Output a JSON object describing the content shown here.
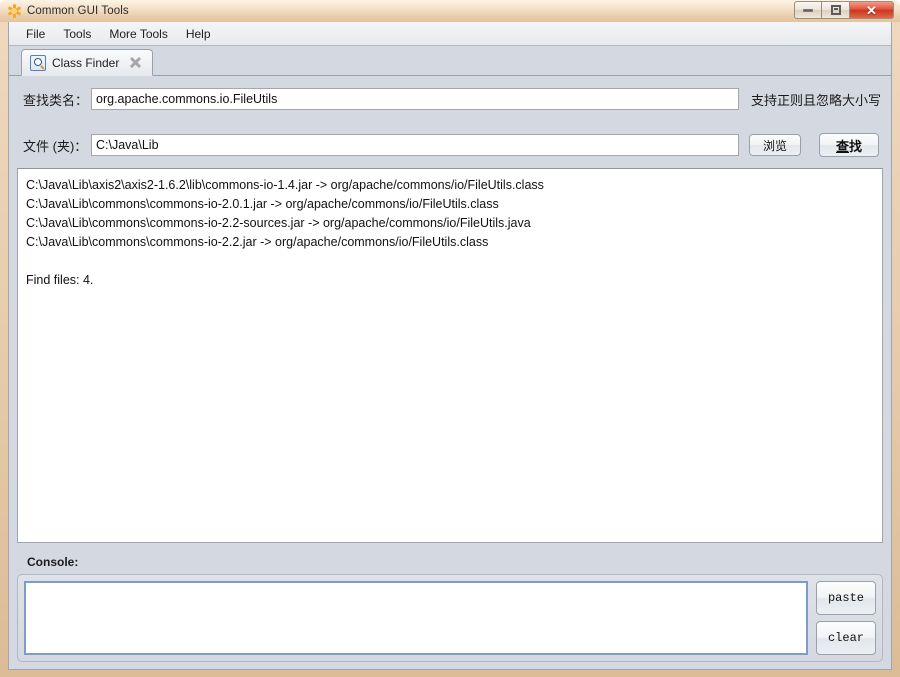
{
  "window": {
    "title": "Common GUI Tools",
    "icon": "asterisk-flower-icon",
    "ghost_text": "",
    "controls": {
      "minimize": "minimize-icon",
      "maximize": "maximize-icon",
      "close": "✕"
    }
  },
  "menu": {
    "items": [
      {
        "label": "File"
      },
      {
        "label": "Tools"
      },
      {
        "label": "More Tools"
      },
      {
        "label": "Help"
      }
    ]
  },
  "tabs": [
    {
      "label": "Class Finder",
      "icon": "magnifier-icon",
      "close_icon": "close-icon",
      "active": true
    }
  ],
  "form": {
    "class_name": {
      "label": "查找类名：",
      "value": "org.apache.commons.io.FileUtils",
      "placeholder": ""
    },
    "hint": "支持正则且忽略大小写",
    "folder": {
      "label": "文件 (夹)：",
      "value": "C:\\Java\\Lib",
      "placeholder": ""
    },
    "browse_button": "浏览",
    "search_button_first_char": "查",
    "search_button_rest": "找"
  },
  "results": {
    "lines": [
      "C:\\Java\\Lib\\axis2\\axis2-1.6.2\\lib\\commons-io-1.4.jar -> org/apache/commons/io/FileUtils.class",
      "C:\\Java\\Lib\\commons\\commons-io-2.0.1.jar -> org/apache/commons/io/FileUtils.class",
      "C:\\Java\\Lib\\commons\\commons-io-2.2-sources.jar -> org/apache/commons/io/FileUtils.java",
      "C:\\Java\\Lib\\commons\\commons-io-2.2.jar -> org/apache/commons/io/FileUtils.class",
      "",
      "Find files: 4."
    ]
  },
  "console": {
    "label": "Console:",
    "value": "",
    "placeholder": "",
    "paste_button": "paste",
    "clear_button": "clear"
  },
  "colors": {
    "window_frame": "#e8cdae",
    "client_bg": "#d4d8e0",
    "close_button": "#c8381f",
    "tab_icon_blue": "#36567f",
    "console_border": "#7d9dc4"
  }
}
